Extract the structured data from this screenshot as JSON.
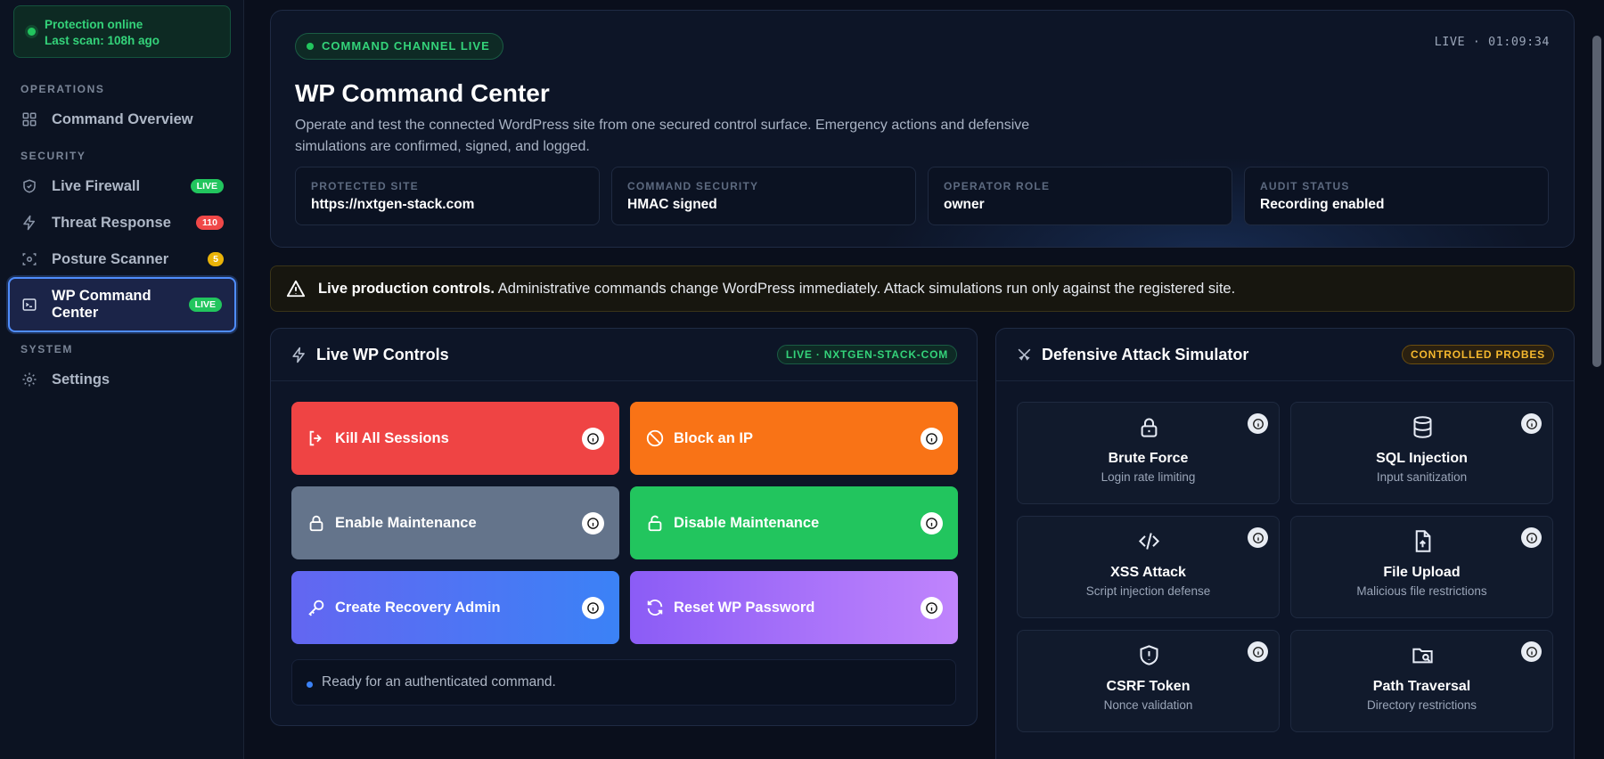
{
  "sidebar": {
    "status": {
      "line1": "Protection online",
      "line2": "Last scan: 108h ago"
    },
    "sections": {
      "operations": "OPERATIONS",
      "security": "SECURITY",
      "system": "SYSTEM"
    },
    "items": [
      {
        "label": "Command Overview",
        "icon": "grid-icon"
      },
      {
        "label": "Live Firewall",
        "icon": "shield-icon",
        "badge": "LIVE",
        "badge_color": "#22c55e"
      },
      {
        "label": "Threat Response",
        "icon": "bolt-icon",
        "badge": "110",
        "badge_color": "#f04848"
      },
      {
        "label": "Posture Scanner",
        "icon": "scan-icon",
        "badge": "5",
        "badge_color": "#eab308"
      },
      {
        "label": "WP Command Center",
        "icon": "terminal-icon",
        "badge": "LIVE",
        "badge_color": "#22c55e",
        "active": true
      },
      {
        "label": "Settings",
        "icon": "gear-icon"
      }
    ]
  },
  "hero": {
    "pill": "COMMAND CHANNEL LIVE",
    "clock": "LIVE · 01:09:34",
    "title": "WP Command Center",
    "description": "Operate and test the connected WordPress site from one secured control surface. Emergency actions and defensive simulations are confirmed, signed, and logged.",
    "stats": [
      {
        "label": "PROTECTED SITE",
        "value": "https://nxtgen-stack.com"
      },
      {
        "label": "COMMAND SECURITY",
        "value": "HMAC signed"
      },
      {
        "label": "OPERATOR ROLE",
        "value": "owner"
      },
      {
        "label": "AUDIT STATUS",
        "value": "Recording enabled"
      }
    ]
  },
  "alert": {
    "bold": "Live production controls.",
    "text": " Administrative commands change WordPress immediately. Attack simulations run only against the registered site."
  },
  "controls": {
    "title": "Live WP Controls",
    "tag": "LIVE · NXTGEN-STACK-COM",
    "buttons": [
      {
        "label": "Kill All Sessions",
        "icon": "logout-icon",
        "color": "#ef4444"
      },
      {
        "label": "Block an IP",
        "icon": "block-icon",
        "color": "#f97316"
      },
      {
        "label": "Enable Maintenance",
        "icon": "lock-icon",
        "color": "#64748b"
      },
      {
        "label": "Disable Maintenance",
        "icon": "unlock-icon",
        "color": "#22c55e"
      },
      {
        "label": "Create Recovery Admin",
        "icon": "key-icon",
        "color": "#3b82f6"
      },
      {
        "label": "Reset WP Password",
        "icon": "refresh-icon",
        "color": "#a855f7"
      }
    ],
    "status": "Ready for an authenticated command."
  },
  "simulator": {
    "title": "Defensive Attack Simulator",
    "tag": "CONTROLLED PROBES",
    "cards": [
      {
        "title": "Brute Force",
        "subtitle": "Login rate limiting",
        "icon": "lock-icon"
      },
      {
        "title": "SQL Injection",
        "subtitle": "Input sanitization",
        "icon": "database-icon"
      },
      {
        "title": "XSS Attack",
        "subtitle": "Script injection defense",
        "icon": "code-icon"
      },
      {
        "title": "File Upload",
        "subtitle": "Malicious file restrictions",
        "icon": "file-upload-icon"
      },
      {
        "title": "CSRF Token",
        "subtitle": "Nonce validation",
        "icon": "shield-alert-icon"
      },
      {
        "title": "Path Traversal",
        "subtitle": "Directory restrictions",
        "icon": "folder-search-icon"
      }
    ]
  }
}
